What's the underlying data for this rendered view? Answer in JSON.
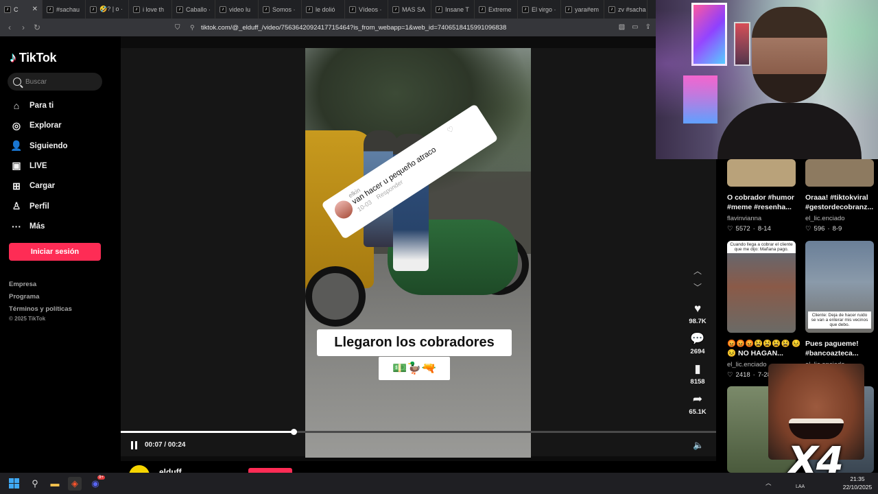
{
  "browser": {
    "tabs": [
      {
        "label": "C",
        "active": true
      },
      {
        "label": "#sachau",
        "active": false
      },
      {
        "label": "🤣? | o ·",
        "active": false
      },
      {
        "label": "i love th",
        "active": false
      },
      {
        "label": "Caballo ·",
        "active": false
      },
      {
        "label": "video lu",
        "active": false
      },
      {
        "label": "Somos ·",
        "active": false
      },
      {
        "label": "le dolió",
        "active": false
      },
      {
        "label": "Vídeos ·",
        "active": false
      },
      {
        "label": "MAS SA",
        "active": false
      },
      {
        "label": "Insane T",
        "active": false
      },
      {
        "label": "Extreme",
        "active": false
      },
      {
        "label": "El virgo ·",
        "active": false
      },
      {
        "label": "yara#em",
        "active": false
      },
      {
        "label": "zv #sacha",
        "active": false
      }
    ],
    "url": "tiktok.com/@_elduff_/video/7563642092417715464?is_from_webapp=1&web_id=7406518415991096838"
  },
  "sidebar": {
    "logo": "TikTok",
    "search_placeholder": "Buscar",
    "nav": [
      {
        "label": "Para ti",
        "icon": "home-icon",
        "glyph": "⌂"
      },
      {
        "label": "Explorar",
        "icon": "compass-icon",
        "glyph": "◎"
      },
      {
        "label": "Siguiendo",
        "icon": "following-icon",
        "glyph": "👤"
      },
      {
        "label": "LIVE",
        "icon": "live-icon",
        "glyph": "▣"
      },
      {
        "label": "Cargar",
        "icon": "upload-icon",
        "glyph": "⊞"
      },
      {
        "label": "Perfil",
        "icon": "profile-icon",
        "glyph": "♙"
      },
      {
        "label": "Más",
        "icon": "more-icon",
        "glyph": "···"
      }
    ],
    "login_button": "Iniciar sesión",
    "footer_links": [
      "Empresa",
      "Programa",
      "Términos y políticas"
    ],
    "copyright": "© 2025 TikTok"
  },
  "video": {
    "comment": {
      "username": "elkin",
      "text": "van hacer u pequeño atraco",
      "date": "10-03",
      "reply": "Responder"
    },
    "caption": "Llegaron los cobradores",
    "caption_emojis": "💵🦆🔫",
    "time_display": "00:07 / 00:24",
    "progress": 0.29
  },
  "actions": {
    "likes": "98.7K",
    "comments": "2694",
    "saves": "8158",
    "shares": "65.1K"
  },
  "author": {
    "name": "elduff"
  },
  "related": [
    {
      "title": "O cobrador #humor #meme #resenha...",
      "author": "flavinvianna",
      "likes": "5572",
      "date": "8-14",
      "thumb_color": "#b9a27a"
    },
    {
      "title": "Oraaa! #tiktokviral #gestordecobranz...",
      "author": "el_lic.enciado",
      "likes": "596",
      "date": "8-9",
      "thumb_color": "#8d7a60"
    },
    {
      "title": "😡😡😡😫😫😫😫 😣😣 NO HAGAN...",
      "author": "el_lic.enciado",
      "likes": "2418",
      "date": "7-28",
      "thumb_color": "#6e7c8a",
      "thumb_text": "Cuando llega a cobrar el cliente que me dijo: Mañana pago."
    },
    {
      "title": "Pues pagueme! #bancoazteca...",
      "author": "el_lic.enciado",
      "likes": "",
      "date": "",
      "thumb_color": "#7f8e9a",
      "thumb_text": "Cliente: Deja de hacer ruido se van a enterar mis vecinos que debo."
    }
  ],
  "meme_overlay": {
    "text": "X4"
  },
  "taskbar": {
    "language": "LAA",
    "time": "21:35",
    "date": "22/10/2025",
    "discord_badge": "9+"
  },
  "colors": {
    "accent": "#fe2c55",
    "background": "#000000",
    "stage": "#161616"
  }
}
